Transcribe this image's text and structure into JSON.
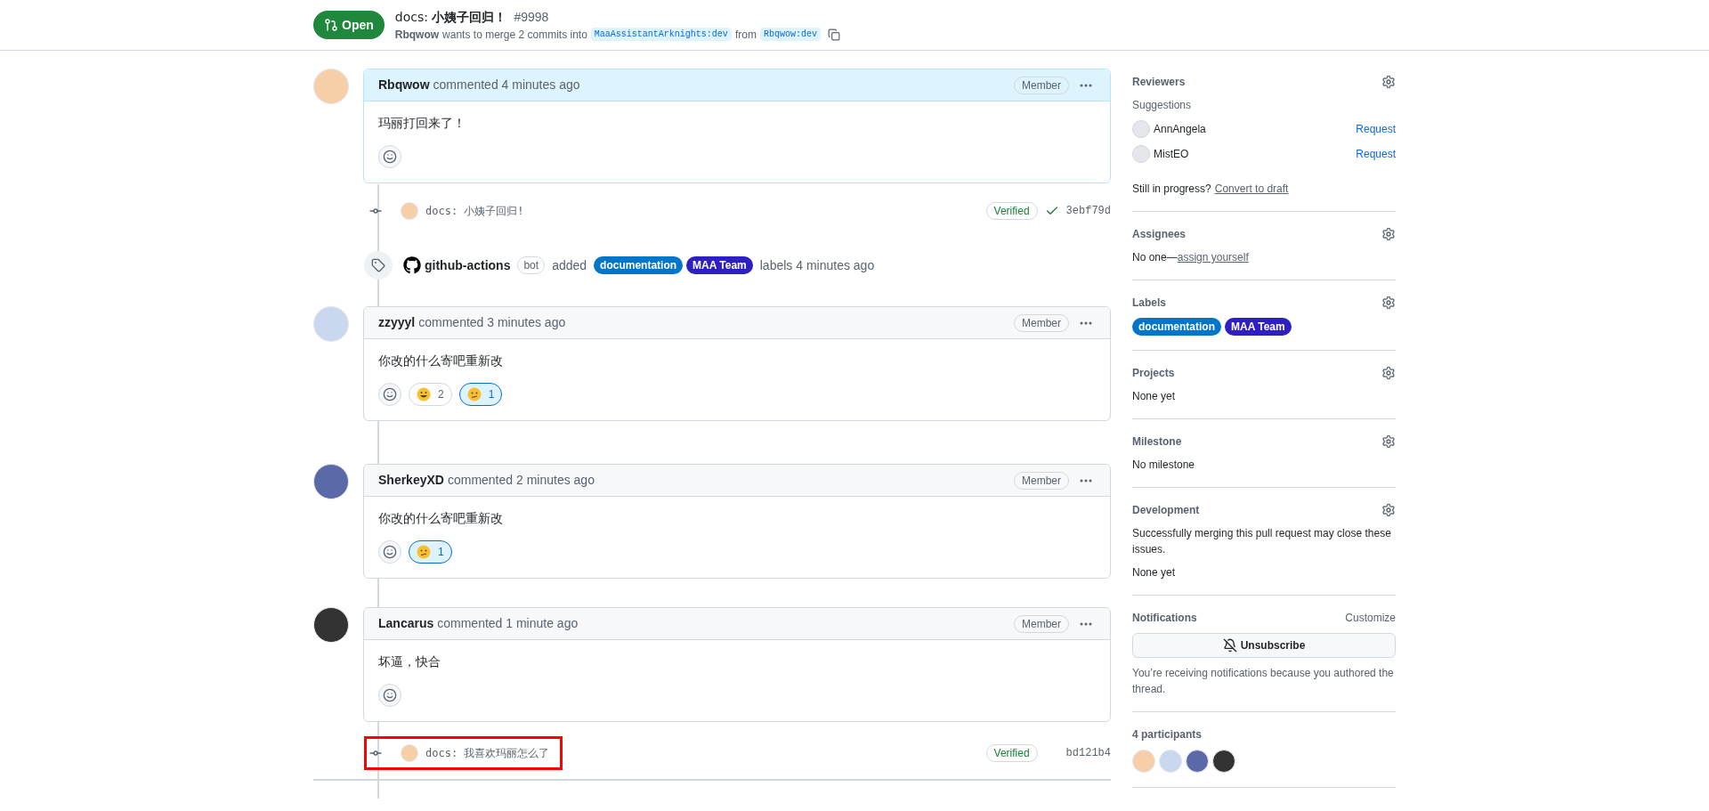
{
  "pull_request": {
    "state": "Open",
    "title": "docs: **小姨子回归！**",
    "number": "#9998",
    "author": "Rbqwow",
    "summary": "wants to merge 2 commits into",
    "base_branch": "MaaAssistantArknights:dev",
    "from_word": "from",
    "head_branch": "Rbqwow:dev"
  },
  "timeline": [
    {
      "kind": "comment",
      "author": "Rbqwow",
      "action": "commented 4 minutes ago",
      "role": "Member",
      "own": true,
      "body": "玛丽打回来了！"
    },
    {
      "kind": "commit",
      "message": "docs: 小姨子回归!",
      "verified": "Verified",
      "check_passed": true,
      "sha": "3ebf79d",
      "highlighted": false
    },
    {
      "kind": "label_event",
      "actor": "github-actions",
      "actor_tag": "bot",
      "verb": "added",
      "labels": [
        {
          "name": "documentation",
          "color": "#0075ca"
        },
        {
          "name": "MAA Team",
          "color": "#2d1fc2"
        }
      ],
      "tail": "labels 4 minutes ago"
    },
    {
      "kind": "comment",
      "author": "zzyyyl",
      "action": "commented 3 minutes ago",
      "role": "Member",
      "own": false,
      "body": "你改的什么寄吧重新改",
      "reactions": [
        {
          "kind": "grin",
          "count": "2",
          "selected": false
        },
        {
          "kind": "confused",
          "count": "1",
          "selected": true
        }
      ]
    },
    {
      "kind": "comment",
      "author": "SherkeyXD",
      "action": "commented 2 minutes ago",
      "role": "Member",
      "own": false,
      "body": "你改的什么寄吧重新改",
      "reactions": [
        {
          "kind": "confused",
          "count": "1",
          "selected": true
        }
      ]
    },
    {
      "kind": "comment",
      "author": "Lancarus",
      "action": "commented 1 minute ago",
      "role": "Member",
      "own": false,
      "body": "坏逼，快合"
    },
    {
      "kind": "commit",
      "message": "docs: 我喜欢玛丽怎么了",
      "verified": "Verified",
      "check_passed": false,
      "sha": "bd121b4",
      "highlighted": true
    }
  ],
  "sidebar": {
    "reviewers": {
      "title": "Reviewers",
      "subtitle": "Suggestions",
      "people": [
        {
          "name": "AnnAngela",
          "action": "Request"
        },
        {
          "name": "MistEO",
          "action": "Request"
        }
      ],
      "note": "Still in progress?",
      "note_link": "Convert to draft"
    },
    "assignees": {
      "title": "Assignees",
      "text": "No one—",
      "link": "assign yourself"
    },
    "labels": {
      "title": "Labels",
      "items": [
        {
          "name": "documentation",
          "color": "#0075ca"
        },
        {
          "name": "MAA Team",
          "color": "#2d1fc2"
        }
      ]
    },
    "projects": {
      "title": "Projects",
      "text": "None yet"
    },
    "milestone": {
      "title": "Milestone",
      "text": "No milestone"
    },
    "development": {
      "title": "Development",
      "text": "Successfully merging this pull request may close these issues.",
      "note": "None yet"
    },
    "notifications": {
      "title": "Notifications",
      "action": "Customize",
      "button": "Unsubscribe",
      "note": "You’re receiving notifications because you authored the thread."
    },
    "participants": {
      "title": "4 participants"
    }
  }
}
